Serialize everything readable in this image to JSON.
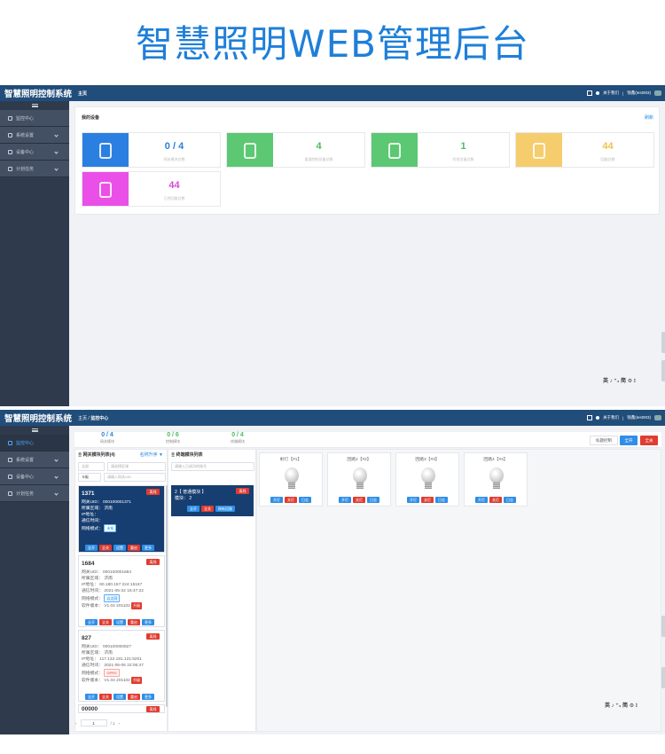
{
  "banner": {
    "title": "智慧照明WEB管理后台"
  },
  "colors": {
    "topbar": "#214d7a",
    "sidebar": "#2f3b4d",
    "banner": "#1e7fd9",
    "primary": "#2f8ee8",
    "danger": "#e03c31"
  },
  "screen1": {
    "app_title": "智慧照明控制系统",
    "crumb": "主页",
    "top_right": {
      "about": "关于我们",
      "user": "钱鑫(test003)"
    },
    "sidebar": [
      {
        "label": "监控中心",
        "icon": "monitor-icon"
      },
      {
        "label": "系统设置",
        "icon": "gear-icon"
      },
      {
        "label": "设备中心",
        "icon": "device-icon"
      },
      {
        "label": "计划任务",
        "icon": "calendar-icon"
      }
    ],
    "card": {
      "title": "我的设备",
      "link": "刷新"
    },
    "stats": [
      {
        "value": "0 / 4",
        "label": "网关模块总数",
        "color": "#2b7fe0",
        "num_color": "#2b7fe0",
        "icon": "gateway-icon"
      },
      {
        "value": "4",
        "label": "离通控制设备总数",
        "color": "#5cc873",
        "num_color": "#4cbb5f",
        "icon": "controller-icon"
      },
      {
        "value": "1",
        "label": "时控设备总数",
        "color": "#5cc873",
        "num_color": "#4cbb5f",
        "icon": "timer-icon"
      },
      {
        "value": "44",
        "label": "回路总数",
        "color": "#f6cd6c",
        "num_color": "#f0c050",
        "icon": "circuit-icon"
      },
      {
        "value": "44",
        "label": "已控回路总数",
        "color": "#ea4fe8",
        "num_color": "#d84ad6",
        "icon": "controlled-circuit-icon"
      }
    ],
    "ime": "英 ♪ ⁺₄ 简 ⚙ ⁝"
  },
  "screen2": {
    "app_title": "智慧照明控制系统",
    "crumb": [
      "主页",
      "/",
      "监控中心"
    ],
    "top_right": {
      "about": "关于我们",
      "user": "钱鑫(test003)"
    },
    "sidebar": [
      {
        "label": "监控中心",
        "icon": "monitor-icon",
        "active": true
      },
      {
        "label": "系统设置",
        "icon": "gear-icon"
      },
      {
        "label": "设备中心",
        "icon": "device-icon"
      },
      {
        "label": "计划任务",
        "icon": "calendar-icon"
      }
    ],
    "summary": [
      {
        "value": "0 / 4",
        "label": "网关模块",
        "color": "#2b7fe0"
      },
      {
        "value": "0 / 6",
        "label": "控制模块",
        "color": "#4cbb5f"
      },
      {
        "value": "0 / 4",
        "label": "终端模块",
        "color": "#4cbb5f"
      }
    ],
    "buttons": {
      "time": "标题控制",
      "all_on": "全开",
      "all_off": "全关"
    },
    "gateway_panel": {
      "title": "网关模块列表(4)",
      "sort": "名称升序 ▼",
      "select1": "全部",
      "select2": "请选择区域",
      "select3": "卡板",
      "search": "请输入网关UID"
    },
    "terminal_panel": {
      "title": "终端模块列表",
      "search": "请输入已成功的账号"
    },
    "gateways": [
      {
        "name": "1371",
        "badge": "离线",
        "uid": "网关UID：  000100001371",
        "area": "所属区域：  济南",
        "ip": "IP地址：",
        "time": "通信时间：",
        "net_label": "网络模式：",
        "net": "未知",
        "selected": true
      },
      {
        "name": "1684",
        "badge": "离线",
        "uid": "网关UID：  000100001684",
        "area": "所属区域：  济南",
        "ip": "IP地址：   60.180.157.224:15167",
        "time": "通信时间：   2021-05-22 15:47:22",
        "net_label": "网络模式：",
        "net": "以太网",
        "ver_label": "软件版本：  V1.04 201102",
        "ver_btn": "升级"
      },
      {
        "name": "827",
        "badge": "离线",
        "uid": "网关UID：  000100000827",
        "area": "所属区域：  济南",
        "ip": "IP地址：   117.132.191.121:5201",
        "time": "通信时间：   2021-06-06 22:06:47",
        "net_label": "网络模式：",
        "net": "GPRS",
        "ver_label": "软件版本：  V1.04 201102",
        "ver_btn": "升级"
      },
      {
        "name": "00000",
        "badge": "离线"
      }
    ],
    "gw_buttons": [
      "全开",
      "全关",
      "设置",
      "重启",
      "更多"
    ],
    "module": {
      "title": "2【 普通模块 】",
      "badge": "离线",
      "line": "模块：  2",
      "buttons": [
        "全开",
        "全关",
        "刷新回路"
      ]
    },
    "bulbs": [
      {
        "title": "射灯【#1】"
      },
      {
        "title": "回路2【#2】"
      },
      {
        "title": "回路3【#3】"
      },
      {
        "title": "回路4【#4】"
      }
    ],
    "bulb_buttons": [
      "开灯",
      "关灯",
      "日志"
    ],
    "pager": {
      "prev": "‹",
      "page": "1",
      "total": "/ 1",
      "next": "›"
    },
    "ime": "英 ♪ ⁺₄ 简 ⚙ ⁝"
  }
}
